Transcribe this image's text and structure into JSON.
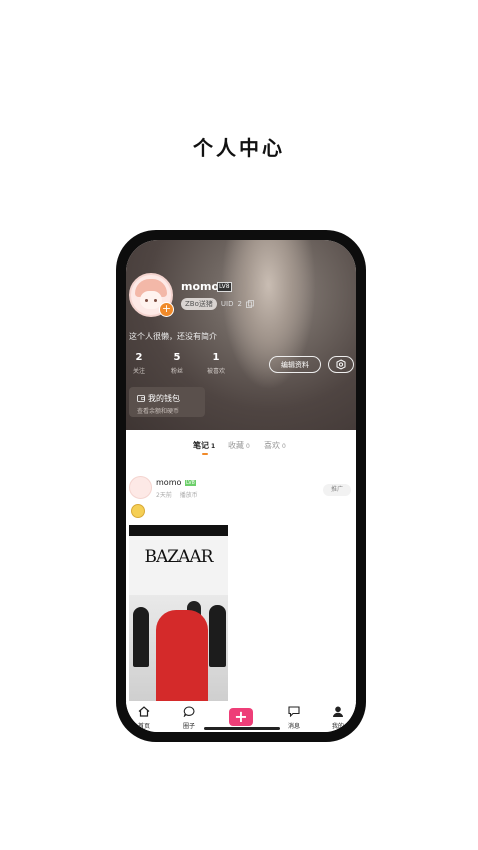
{
  "headline": "个人中心",
  "profile": {
    "username": "momo",
    "level_badge": "LV8",
    "tag_label": "ZBo送猪",
    "uid_label": "UID",
    "uid_value": "2",
    "bio": "这个人很懒，还没有简介",
    "stats": [
      {
        "value": "2",
        "label": "关注"
      },
      {
        "value": "5",
        "label": "粉丝"
      },
      {
        "value": "1",
        "label": "被喜欢"
      }
    ],
    "edit_button": "编辑资料",
    "wallet_title": "我的钱包",
    "wallet_subtitle": "查看余额和硬币"
  },
  "tabs": [
    {
      "label": "笔记",
      "count": "1",
      "active": true
    },
    {
      "label": "收藏",
      "count": "0",
      "active": false
    },
    {
      "label": "喜欢",
      "count": "0",
      "active": false
    }
  ],
  "post": {
    "author": "momo",
    "level_badge": "LV8",
    "time": "2天前",
    "source": "播放币",
    "promo_button": "推广",
    "image_title": "BAZAAR"
  },
  "nav": [
    {
      "label": "首页",
      "icon": "home-icon"
    },
    {
      "label": "圈子",
      "icon": "chat-bubble-icon"
    },
    {
      "label": "",
      "icon": "plus-icon"
    },
    {
      "label": "消息",
      "icon": "message-icon"
    },
    {
      "label": "我的",
      "icon": "person-icon"
    }
  ],
  "colors": {
    "accent": "#f08a2a",
    "plus_button": "#ee3e78"
  }
}
